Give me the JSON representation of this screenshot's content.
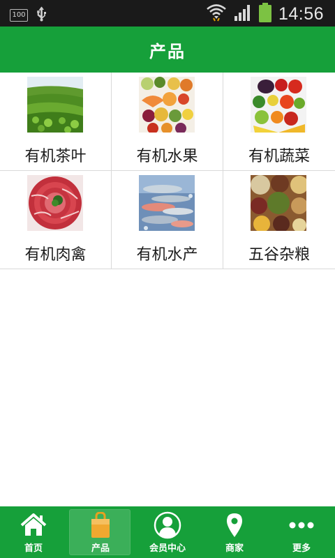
{
  "status_bar": {
    "battery_badge": "100",
    "time": "14:56",
    "icons": [
      "battery-saver-icon",
      "usb-icon",
      "wifi-icon",
      "signal-icon",
      "battery-icon"
    ]
  },
  "header": {
    "title": "产品"
  },
  "products": [
    {
      "label": "有机茶叶",
      "image": "tea-field-image"
    },
    {
      "label": "有机水果",
      "image": "fruit-platter-image"
    },
    {
      "label": "有机蔬菜",
      "image": "vegetable-pile-image"
    },
    {
      "label": "有机肉禽",
      "image": "sliced-meat-image"
    },
    {
      "label": "有机水产",
      "image": "fish-on-ice-image"
    },
    {
      "label": "五谷杂粮",
      "image": "grains-beans-image"
    }
  ],
  "bottom_nav": {
    "items": [
      {
        "label": "首页",
        "icon": "home-icon",
        "active": false
      },
      {
        "label": "产品",
        "icon": "shopping-bag-icon",
        "active": true
      },
      {
        "label": "会员中心",
        "icon": "member-icon",
        "active": false
      },
      {
        "label": "商家",
        "icon": "location-pin-icon",
        "active": false
      },
      {
        "label": "更多",
        "icon": "more-icon",
        "active": false
      }
    ]
  },
  "colors": {
    "brand_green": "#16a03a",
    "status_bar": "#1a1a1a",
    "battery_green": "#7cc243"
  }
}
